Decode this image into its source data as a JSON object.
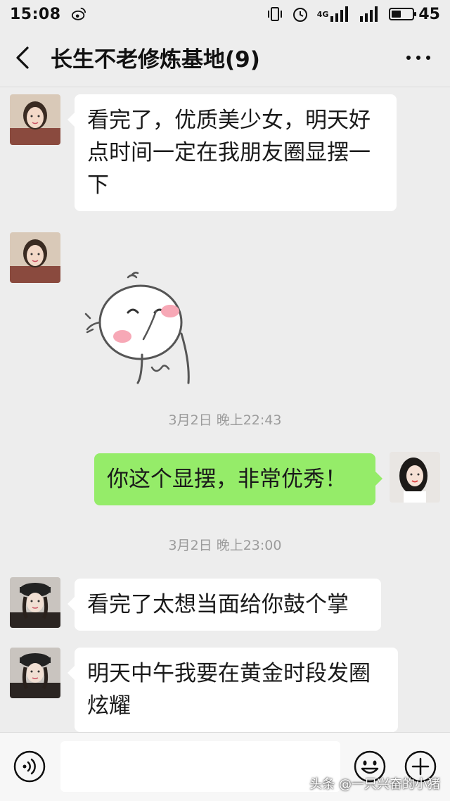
{
  "status_bar": {
    "time": "15:08",
    "network": "4G",
    "battery": "45",
    "battery_level": 0.45,
    "icons": [
      "weibo-icon",
      "vibrate-icon",
      "alarm-icon",
      "signal-icon",
      "battery-icon"
    ]
  },
  "header": {
    "title": "长生不老修炼基地(9)",
    "back_icon": "chevron-left-icon",
    "more_icon": "more-dots-icon"
  },
  "messages": [
    {
      "side": "left",
      "type": "text",
      "avatar": "avatar-woman-1",
      "text": "看完了，优质美少女，明天好点时间一定在我朋友圈显摆一下"
    },
    {
      "side": "left",
      "type": "sticker",
      "avatar": "avatar-woman-1",
      "sticker": "shy-blushing-face-sticker"
    },
    {
      "type": "timestamp",
      "text": "3月2日 晚上22:43"
    },
    {
      "side": "right",
      "type": "text",
      "avatar": "avatar-self",
      "text": "你这个显摆，非常优秀！"
    },
    {
      "type": "timestamp",
      "text": "3月2日 晚上23:00"
    },
    {
      "side": "left",
      "type": "text",
      "avatar": "avatar-woman-2",
      "text": "看完了太想当面给你鼓个掌"
    },
    {
      "side": "left",
      "type": "text",
      "avatar": "avatar-woman-2",
      "text": "明天中午我要在黄金时段发圈炫耀"
    }
  ],
  "input_bar": {
    "voice_icon": "voice-icon",
    "input_value": "",
    "emoji_icon": "emoji-icon",
    "plus_icon": "plus-icon"
  },
  "watermark": "头条 @一只兴奋的小猪",
  "colors": {
    "background": "#ededed",
    "bubble_self": "#95ec69",
    "bubble_other": "#ffffff",
    "timestamp": "#9b9b9b"
  }
}
